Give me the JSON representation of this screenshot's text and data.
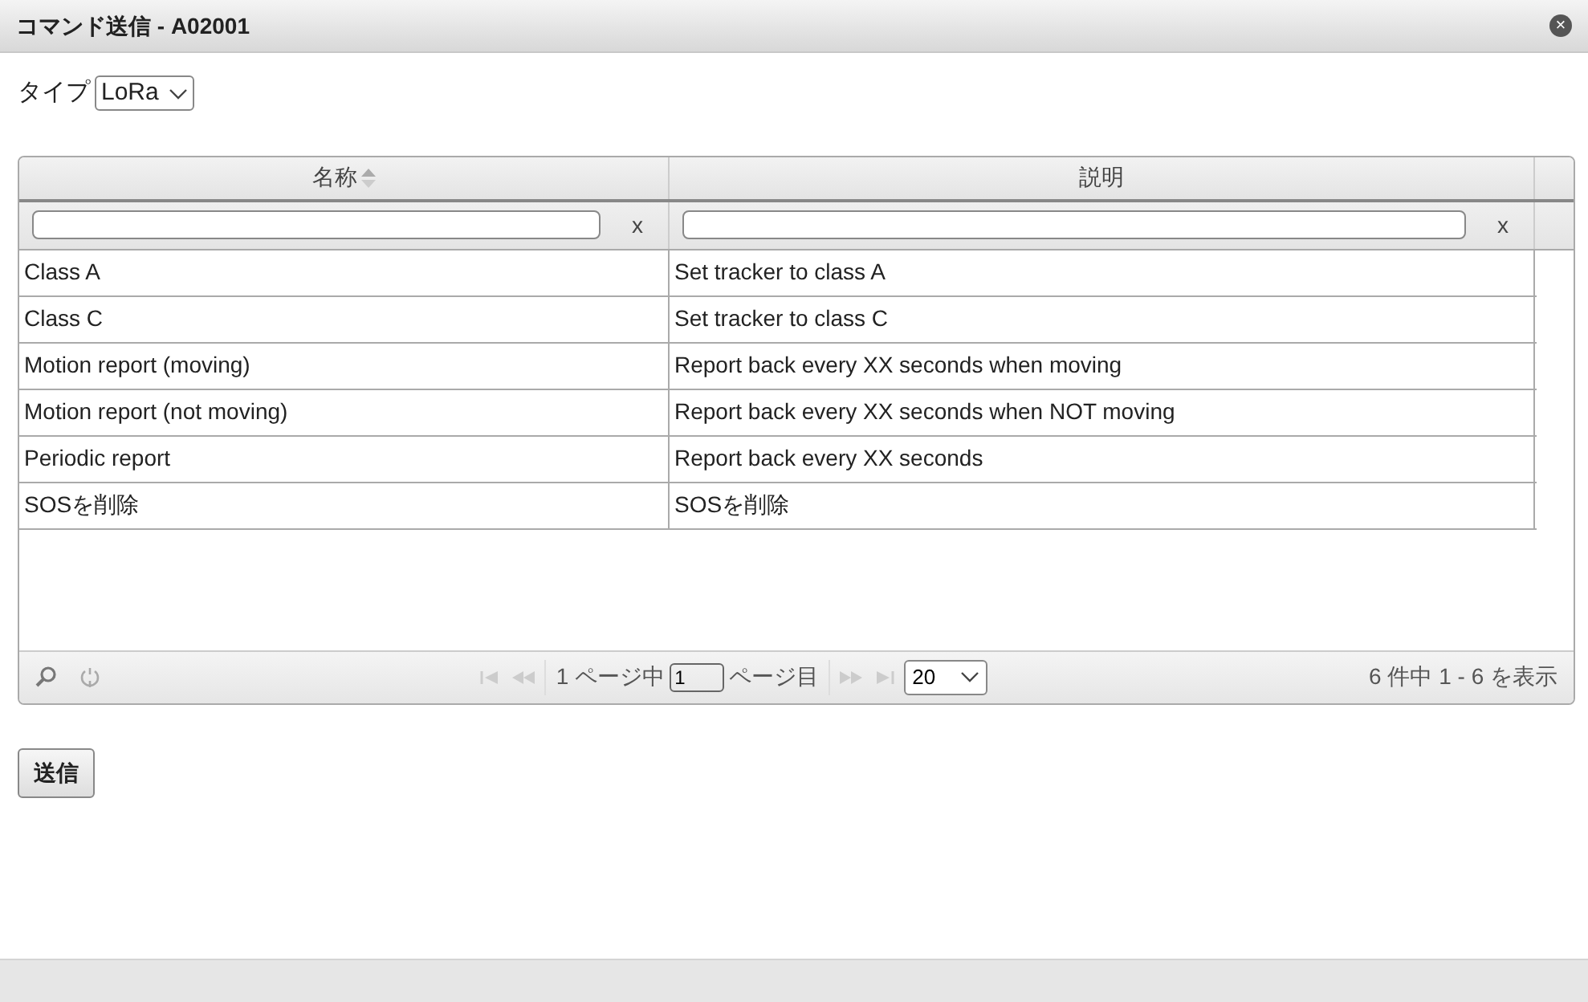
{
  "window": {
    "title": "コマンド送信 - A02001",
    "close": "×"
  },
  "type_field": {
    "label": "タイプ",
    "value": "LoRa"
  },
  "table": {
    "columns": [
      {
        "label": "名称",
        "sortable": true
      },
      {
        "label": "説明",
        "sortable": false
      }
    ],
    "filters": [
      {
        "clear": "x"
      },
      {
        "clear": "x"
      }
    ],
    "rows": [
      {
        "cells": [
          "Class A",
          "Set tracker to class A"
        ]
      },
      {
        "cells": [
          "Class C",
          "Set tracker to class C"
        ]
      },
      {
        "cells": [
          "Motion report (moving)",
          "Report back every XX seconds when moving"
        ]
      },
      {
        "cells": [
          "Motion report (not moving)",
          "Report back every XX seconds when NOT moving"
        ]
      },
      {
        "cells": [
          "Periodic report",
          "Report back every XX seconds"
        ]
      },
      {
        "cells": [
          "SOSを削除",
          "SOSを削除"
        ]
      }
    ]
  },
  "pager": {
    "page_before": "1 ページ中",
    "page_value": "1",
    "page_after": "ページ目",
    "page_size": "20",
    "summary": "6 件中 1 - 6 を表示"
  },
  "submit": "送信"
}
